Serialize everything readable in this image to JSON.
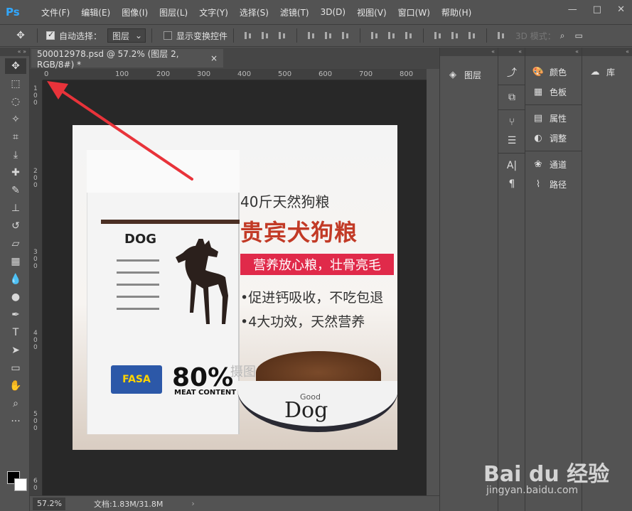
{
  "app": {
    "logo": "Ps"
  },
  "menu": [
    "文件(F)",
    "编辑(E)",
    "图像(I)",
    "图层(L)",
    "文字(Y)",
    "选择(S)",
    "滤镜(T)",
    "3D(D)",
    "视图(V)",
    "窗口(W)",
    "帮助(H)"
  ],
  "window_controls": {
    "minimize": "—",
    "maximize": "□",
    "close": "✕"
  },
  "options": {
    "auto_select_label": "自动选择：",
    "auto_select_checked": true,
    "layer_select_value": "图层",
    "show_transform_label": "显示变换控件",
    "show_transform_checked": false,
    "mode_3d": "3D 模式："
  },
  "document": {
    "tab_title": "500012978.psd @ 57.2% (图层 2, RGB/8#) *",
    "tab_close": "×"
  },
  "ruler_top": [
    "0",
    "100",
    "200",
    "300",
    "400",
    "500",
    "600",
    "700",
    "800"
  ],
  "ruler_left": [
    "1",
    "0",
    "0",
    "2",
    "0",
    "0",
    "3",
    "0",
    "0",
    "4",
    "0",
    "0",
    "5",
    "0",
    "0",
    "6",
    "0",
    "0"
  ],
  "image": {
    "bag_brand": "DOG",
    "bag_badge": "FASA",
    "bag_percent": "80%",
    "bag_meat": "MEAT CONTENT",
    "subtitle": "40斤天然狗粮",
    "title": "贵宾犬狗粮",
    "banner": "营养放心粮，壮骨亮毛",
    "bullet1": "•促进钙吸收，不吃包退",
    "bullet2": "•4大功效，天然营养",
    "bowl_small": "Good",
    "bowl_big": "Dog",
    "watermark": "摄图"
  },
  "status": {
    "zoom": "57.2%",
    "doc_info": "文档:1.83M/31.8M",
    "arrow": "›"
  },
  "panels": {
    "layers": "图层",
    "color": "颜色",
    "swatches": "色板",
    "properties": "属性",
    "adjustments": "调整",
    "channels": "通道",
    "paths": "路径",
    "library": "库"
  },
  "watermark": {
    "brand": "Bai du 经验",
    "url": "jingyan.baidu.com"
  },
  "colors": {
    "accent_arrow": "#e8333a",
    "title_red": "#c23a26",
    "banner_red": "#e02a4a"
  }
}
